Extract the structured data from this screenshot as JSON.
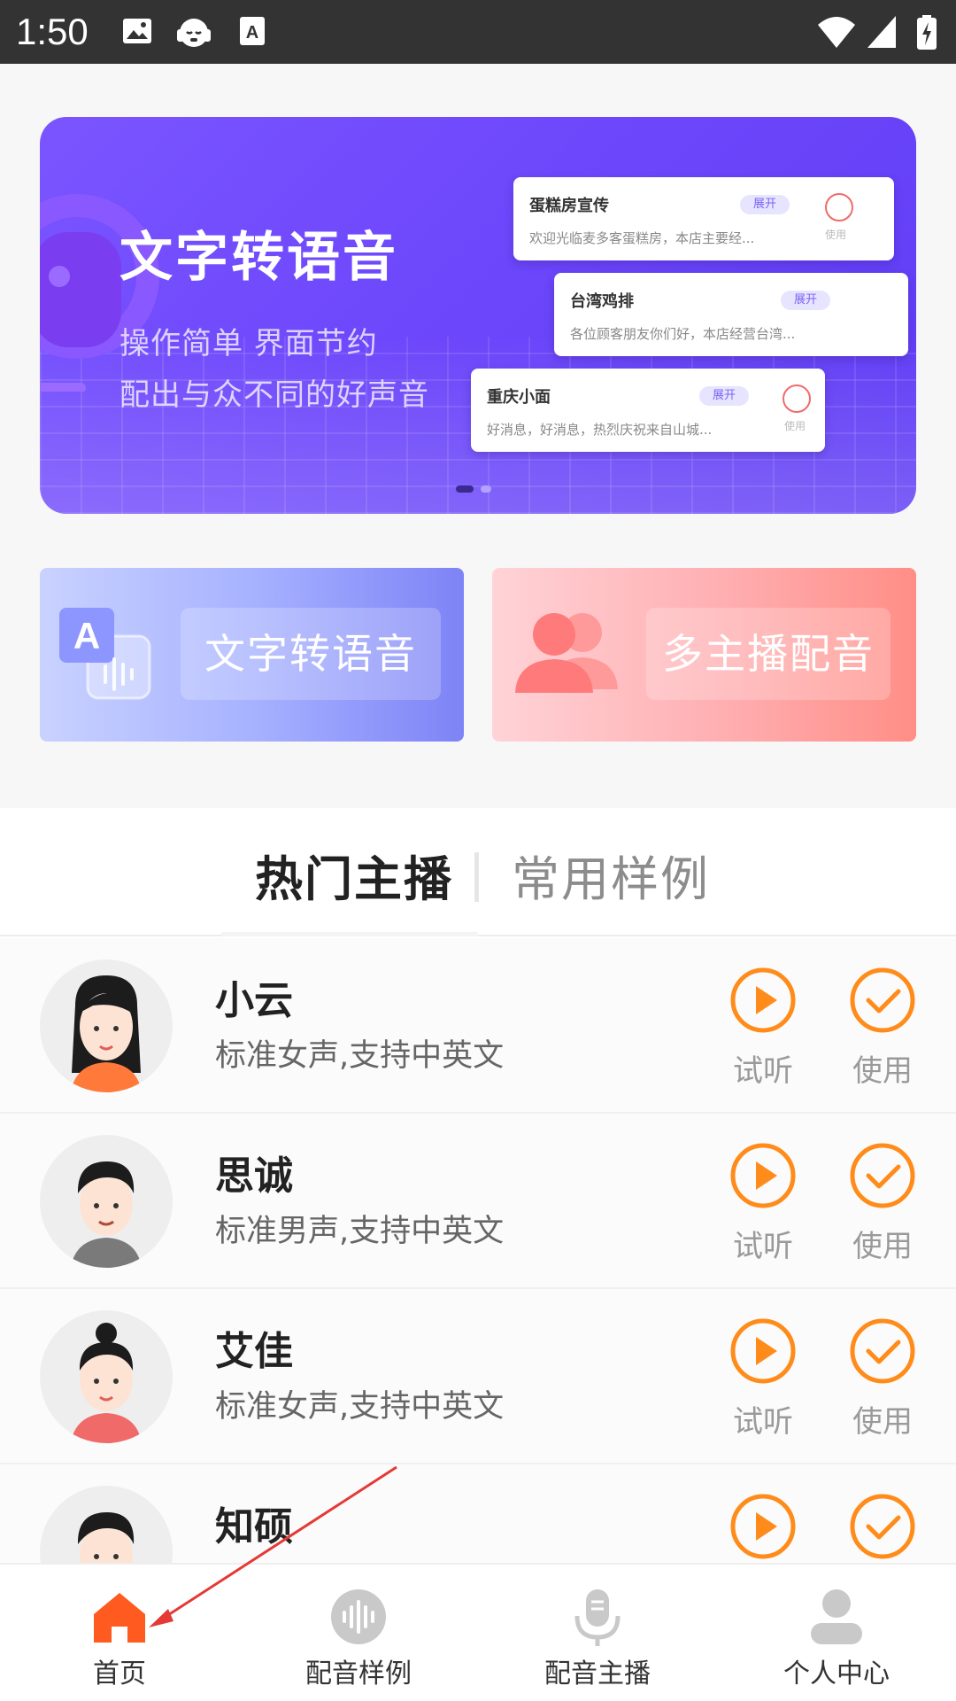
{
  "status_bar": {
    "time": "1:50"
  },
  "banner": {
    "title": "文字转语音",
    "subtitle_line1": "操作简单 界面节约",
    "subtitle_line2": "配出与众不同的好声音",
    "cards": [
      {
        "title": "蛋糕房宣传",
        "expand": "展开",
        "desc": "欢迎光临麦多客蛋糕房，本店主要经...",
        "use": "使用"
      },
      {
        "title": "台湾鸡排",
        "expand": "展开",
        "desc": "各位顾客朋友你们好，本店经营台湾...",
        "use": "使用"
      },
      {
        "title": "重庆小面",
        "expand": "展开",
        "desc": "好消息，好消息，热烈庆祝来自山城...",
        "use": "使用"
      }
    ],
    "carousel_active_index": 0,
    "carousel_count": 2
  },
  "features": [
    {
      "label": "文字转语音",
      "color": "#7e83f6"
    },
    {
      "label": "多主播配音",
      "color": "#ff8e86"
    }
  ],
  "tabs": [
    {
      "label": "热门主播",
      "active": true
    },
    {
      "label": "常用样例",
      "active": false
    }
  ],
  "anchors": [
    {
      "name": "小云",
      "desc": "标准女声,支持中英文",
      "listen": "试听",
      "use": "使用",
      "avatar": "female-long-hair-avatar"
    },
    {
      "name": "思诚",
      "desc": "标准男声,支持中英文",
      "listen": "试听",
      "use": "使用",
      "avatar": "male-avatar"
    },
    {
      "name": "艾佳",
      "desc": "标准女声,支持中英文",
      "listen": "试听",
      "use": "使用",
      "avatar": "female-bun-avatar"
    },
    {
      "name": "知硕",
      "desc": "",
      "listen": "",
      "use": "",
      "avatar": "male-avatar"
    }
  ],
  "nav": [
    {
      "label": "首页",
      "icon": "home-icon",
      "active": true
    },
    {
      "label": "配音样例",
      "icon": "soundwave-icon",
      "active": false
    },
    {
      "label": "配音主播",
      "icon": "microphone-icon",
      "active": false
    },
    {
      "label": "个人中心",
      "icon": "person-icon",
      "active": false
    }
  ],
  "colors": {
    "accent": "#ff8c1a",
    "home_active": "#ff5a1f",
    "banner": "#6d47fb"
  }
}
